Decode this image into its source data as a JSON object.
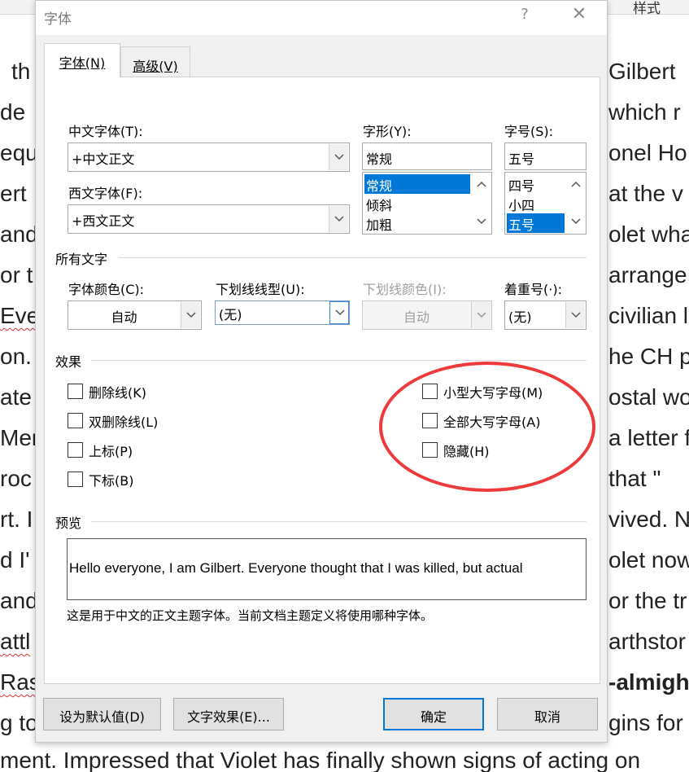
{
  "document": {
    "style_tab": "样式",
    "lines": [
      {
        "left": "th",
        "right": "Gilbert"
      },
      {
        "left": "de",
        "right": "which r"
      },
      {
        "left": "equ",
        "right": "onel Ho"
      },
      {
        "left": "ert",
        "right": "at the v"
      },
      {
        "left": "and",
        "right": "olet wha"
      },
      {
        "left": "or t",
        "right": "arrange"
      },
      {
        "left": "Eve",
        "right": "civilian l"
      },
      {
        "left": "on.",
        "right": "he CH p"
      },
      {
        "left": "ate",
        "right": "ostal wo"
      },
      {
        "left": "Mer",
        "right": "a letter f"
      },
      {
        "left": "roc",
        "right": "that \""
      },
      {
        "left": "rt. I",
        "right": "vived. N"
      },
      {
        "left": "d I'",
        "right": "olet now"
      },
      {
        "left": "and",
        "right": "or the tr"
      },
      {
        "left": "attl",
        "right": "arthstor"
      },
      {
        "left": "Rast",
        "right": "-almigh"
      },
      {
        "left": "g to",
        "right": "gins for"
      },
      {
        "left": "ment. Impressed that Violet has finally shown signs of acting on",
        "right": ""
      }
    ]
  },
  "dialog": {
    "title": "字体",
    "help_glyph": "?",
    "close_glyph": "✕",
    "tabs": [
      {
        "label": "字体(N)"
      },
      {
        "label": "高级(V)"
      }
    ],
    "labels": {
      "chinese_font": "中文字体(T):",
      "western_font": "西文字体(F):",
      "font_style": "字形(Y):",
      "font_size": "字号(S):",
      "all_text": "所有文字",
      "font_color": "字体颜色(C):",
      "underline_style": "下划线线型(U):",
      "underline_color": "下划线颜色(I):",
      "emphasis_mark": "着重号(·):",
      "effects": "效果",
      "preview": "预览"
    },
    "values": {
      "chinese_font": "+中文正文",
      "western_font": "+西文正文",
      "font_style": "常规",
      "font_size": "五号",
      "font_color": "自动",
      "underline_style": "(无)",
      "underline_color": "自动",
      "emphasis_mark": "(无)"
    },
    "style_list": [
      "常规",
      "倾斜",
      "加粗"
    ],
    "size_list": [
      "四号",
      "小四",
      "五号"
    ],
    "effects": {
      "left": [
        {
          "label": "删除线(K)",
          "checked": false
        },
        {
          "label": "双删除线(L)",
          "checked": false
        },
        {
          "label": "上标(P)",
          "checked": false
        },
        {
          "label": "下标(B)",
          "checked": false
        }
      ],
      "right": [
        {
          "label": "小型大写字母(M)",
          "checked": false
        },
        {
          "label": "全部大写字母(A)",
          "checked": false
        },
        {
          "label": "隐藏(H)",
          "checked": false
        }
      ]
    },
    "preview_text": "Hello everyone, I am Gilbert. Everyone thought that I was killed, but actual",
    "preview_note": "这是用于中文的正文主题字体。当前文档主题定义将使用哪种字体。",
    "buttons": {
      "set_default": "设为默认值(D)",
      "text_effects": "文字效果(E)...",
      "ok": "确定",
      "cancel": "取消"
    }
  },
  "colors": {
    "selection": "#0078d7",
    "annotation": "#ee3a3a"
  }
}
